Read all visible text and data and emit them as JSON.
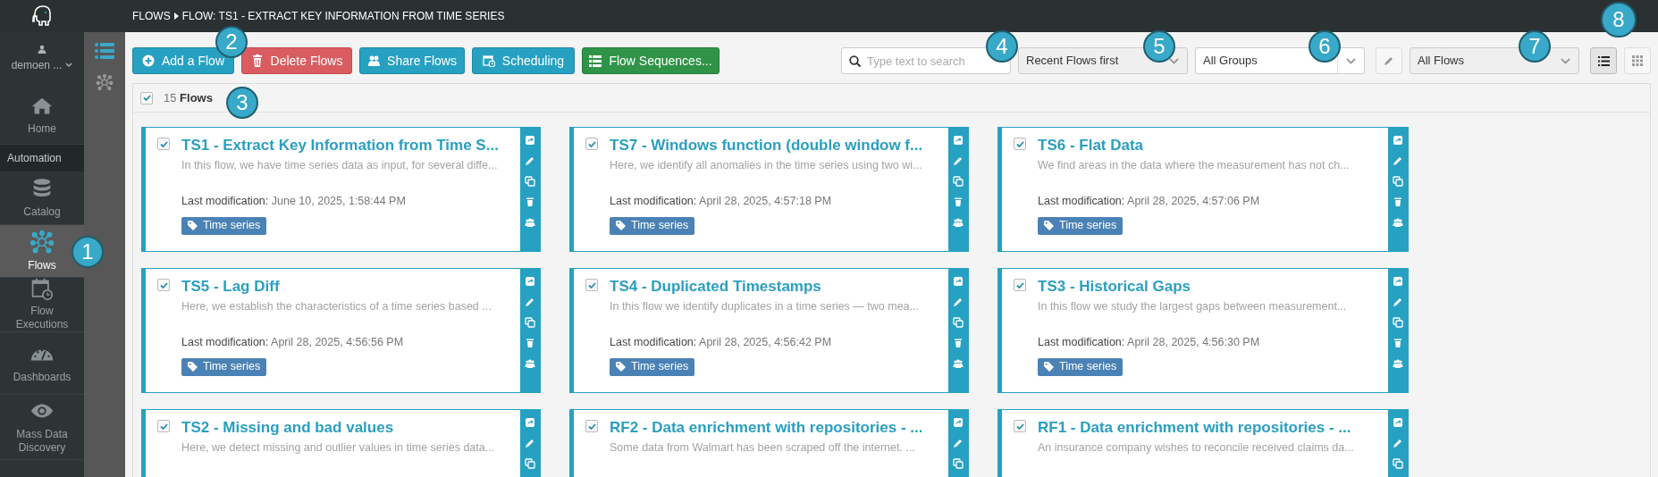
{
  "user": {
    "name": "demoen ..."
  },
  "nav": [
    {
      "kind": "item",
      "label": "Home",
      "selected": false
    },
    {
      "kind": "section",
      "label": "Automation"
    },
    {
      "kind": "item",
      "label": "Catalog",
      "selected": false
    },
    {
      "kind": "item",
      "label": "Flows",
      "selected": true
    },
    {
      "kind": "item",
      "label": "Flow Executions",
      "selected": false
    },
    {
      "kind": "item",
      "label": "Dashboards",
      "selected": false
    },
    {
      "kind": "item",
      "label": "Mass Data Discovery",
      "selected": false
    }
  ],
  "subnav": [
    {
      "selected": true
    },
    {
      "selected": false
    }
  ],
  "breadcrumb": [
    "FLOWS",
    "FLOW: TS1 - EXTRACT KEY INFORMATION FROM TIME SERIES"
  ],
  "actions": [
    {
      "label": "Add a Flow",
      "kind": "primary"
    },
    {
      "label": "Delete Flows",
      "kind": "danger"
    },
    {
      "label": "Share Flows",
      "kind": "primary"
    },
    {
      "label": "Scheduling",
      "kind": "primary"
    },
    {
      "label": "Flow Sequences...",
      "kind": "success"
    }
  ],
  "search": {
    "placeholder": "Type text to search"
  },
  "sort": {
    "value": "Recent Flows first"
  },
  "group": {
    "value": "All Groups"
  },
  "filter": {
    "value": "All Flows"
  },
  "views": [
    {
      "selected": true
    },
    {
      "selected": false
    }
  ],
  "header": {
    "checked": true,
    "count": "15",
    "label": "Flows"
  },
  "flows": [
    {
      "checked": true,
      "title": "TS1 - Extract Key Information from Time S...",
      "description": "In this flow, we have time series data as input, for several diffe...",
      "modified_label": "Last modification:",
      "modified": "June 10, 2025, 1:58:44 PM",
      "tag": "Time series"
    },
    {
      "checked": true,
      "title": "TS7 - Windows function (double window f...",
      "description": "Here, we identify all anomalies in the time series using two wi...",
      "modified_label": "Last modification:",
      "modified": "April 28, 2025, 4:57:18 PM",
      "tag": "Time series"
    },
    {
      "checked": true,
      "title": "TS6 - Flat Data",
      "description": "We find areas in the data where the measurement has not ch...",
      "modified_label": "Last modification:",
      "modified": "April 28, 2025, 4:57:06 PM",
      "tag": "Time series"
    },
    {
      "checked": true,
      "title": "TS5 - Lag Diff",
      "description": "Here, we establish the characteristics of a time series based ...",
      "modified_label": "Last modification:",
      "modified": "April 28, 2025, 4:56:56 PM",
      "tag": "Time series"
    },
    {
      "checked": true,
      "title": "TS4 - Duplicated Timestamps",
      "description": "In this flow we identify duplicates in a time series — two mea...",
      "modified_label": "Last modification:",
      "modified": "April 28, 2025, 4:56:42 PM",
      "tag": "Time series"
    },
    {
      "checked": true,
      "title": "TS3 - Historical Gaps",
      "description": "In this flow we study the largest gaps between measurement...",
      "modified_label": "Last modification:",
      "modified": "April 28, 2025, 4:56:30 PM",
      "tag": "Time series"
    },
    {
      "checked": true,
      "title": "TS2 - Missing and bad values",
      "description": "Here, we detect missing and outlier values in time series data..."
    },
    {
      "checked": true,
      "title": "RF2 - Data enrichment with repositories - ...",
      "description": "Some data from Walmart has been scraped off the internet. ..."
    },
    {
      "checked": true,
      "title": "RF1 - Data enrichment with repositories - ...",
      "description": "An insurance company wishes to reconcile received claims da..."
    }
  ],
  "callouts": [
    "1",
    "2",
    "3",
    "4",
    "5",
    "6",
    "7",
    "8"
  ]
}
